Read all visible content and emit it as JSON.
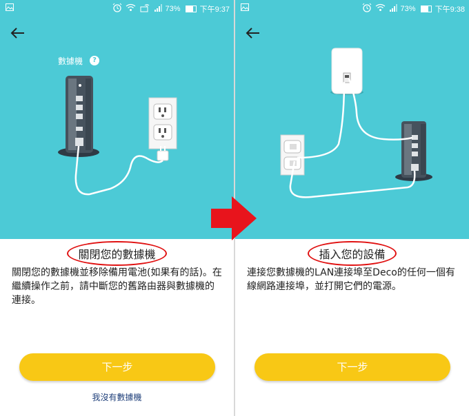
{
  "colors": {
    "hero_bg": "#4ccad6",
    "button": "#f8c815",
    "link": "#1f3f7a",
    "highlight": "#e01010"
  },
  "left": {
    "status": {
      "percent": "73%",
      "time": "下午9:37"
    },
    "modem_label": "數據機",
    "help_icon": "?",
    "title": "關閉您的數據機",
    "description": "關閉您的數據機並移除備用電池(如果有的話)。在繼續操作之前，請中斷您的舊路由器與數據機的連接。",
    "next_label": "下一步",
    "no_modem_link": "我沒有數據機"
  },
  "right": {
    "status": {
      "percent": "73%",
      "time": "下午9:38"
    },
    "title": "插入您的設備",
    "description": "連接您數據機的LAN連接埠至Deco的任何一個有線網路連接埠，並打開它們的電源。",
    "next_label": "下一步"
  },
  "icons": [
    "back-arrow-icon",
    "alarm-icon",
    "wifi-icon",
    "hotspot-icon",
    "signal-icon",
    "battery-icon",
    "gallery-icon",
    "question-icon",
    "red-arrow-icon"
  ]
}
